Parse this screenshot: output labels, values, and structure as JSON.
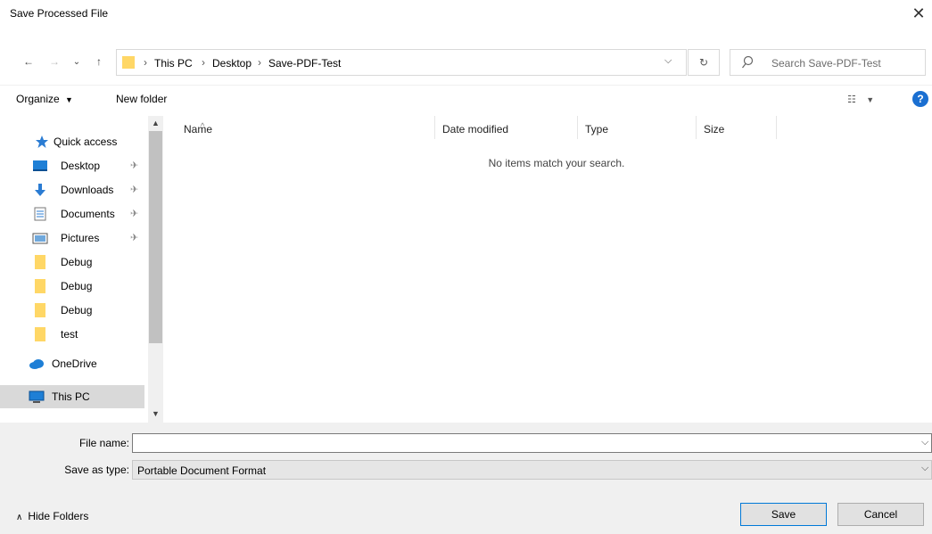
{
  "window": {
    "title": "Save Processed File"
  },
  "address": {
    "crumbs": [
      "This PC",
      "Desktop",
      "Save-PDF-Test"
    ]
  },
  "search": {
    "placeholder": "Search Save-PDF-Test"
  },
  "toolbar": {
    "organize_label": "Organize",
    "new_folder_label": "New folder"
  },
  "nav_pane": {
    "items": [
      {
        "label": "Quick access",
        "icon": "star-pin-icon",
        "pinned": false
      },
      {
        "label": "Desktop",
        "icon": "desktop-icon",
        "pinned": true
      },
      {
        "label": "Downloads",
        "icon": "download-arrow-icon",
        "pinned": true
      },
      {
        "label": "Documents",
        "icon": "documents-icon",
        "pinned": true
      },
      {
        "label": "Pictures",
        "icon": "pictures-icon",
        "pinned": true
      },
      {
        "label": "Debug",
        "icon": "folder-icon",
        "pinned": false
      },
      {
        "label": "Debug",
        "icon": "folder-icon",
        "pinned": false
      },
      {
        "label": "Debug",
        "icon": "folder-icon",
        "pinned": false
      },
      {
        "label": "test",
        "icon": "folder-icon",
        "pinned": false
      },
      {
        "label": "OneDrive",
        "icon": "cloud-icon",
        "pinned": false
      },
      {
        "label": "This PC",
        "icon": "computer-icon",
        "pinned": false,
        "selected": true
      }
    ]
  },
  "file_list": {
    "columns": [
      "Name",
      "Date modified",
      "Type",
      "Size"
    ],
    "empty_message": "No items match your search."
  },
  "form": {
    "file_name_label": "File name:",
    "file_name_value": "",
    "save_as_type_label": "Save as type:",
    "save_as_type_value": "Portable Document Format"
  },
  "footer": {
    "hide_folders_label": "Hide Folders",
    "save_label": "Save",
    "cancel_label": "Cancel"
  },
  "colors": {
    "accent": "#0078d7",
    "folder": "#ffd766",
    "help": "#1a6fd1"
  }
}
